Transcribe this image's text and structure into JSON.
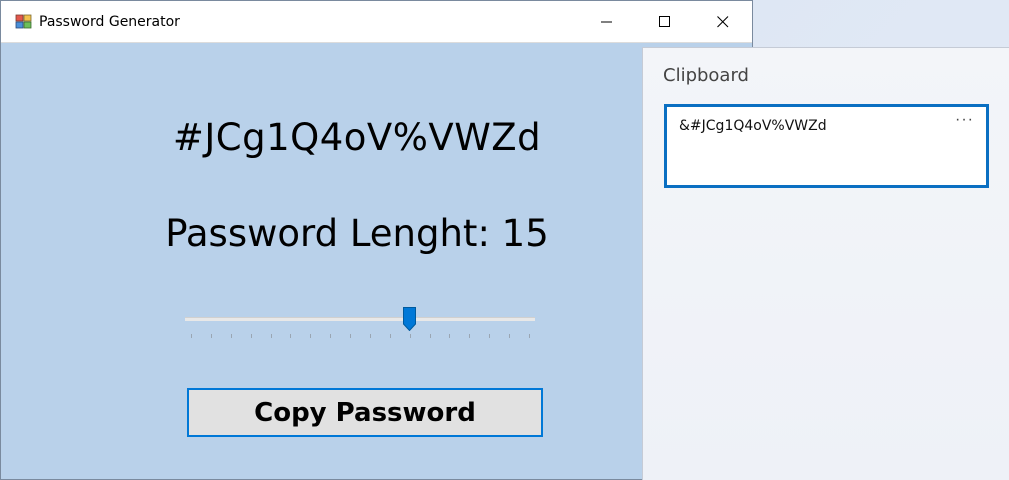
{
  "window": {
    "title": "Password Generator",
    "icon": "app-icon",
    "controls": [
      "minimize-icon",
      "maximize-icon",
      "close-icon"
    ]
  },
  "main": {
    "password": "#JCg1Q4oV%VWZd",
    "length_label": "Password Lenght: 15",
    "slider": {
      "min": 0,
      "max": 17,
      "value": 11,
      "tick_count": 18
    },
    "copy_button_label": "Copy Password"
  },
  "clipboard": {
    "title": "Clipboard",
    "items": [
      {
        "text": "&#JCg1Q4oV%VWZd",
        "more_icon": "ellipsis-icon"
      }
    ]
  },
  "colors": {
    "window_bg": "#b9d1ea",
    "accent": "#0078d7",
    "button_bg": "#e1e1e1",
    "clip_border": "#0a6fc2"
  }
}
